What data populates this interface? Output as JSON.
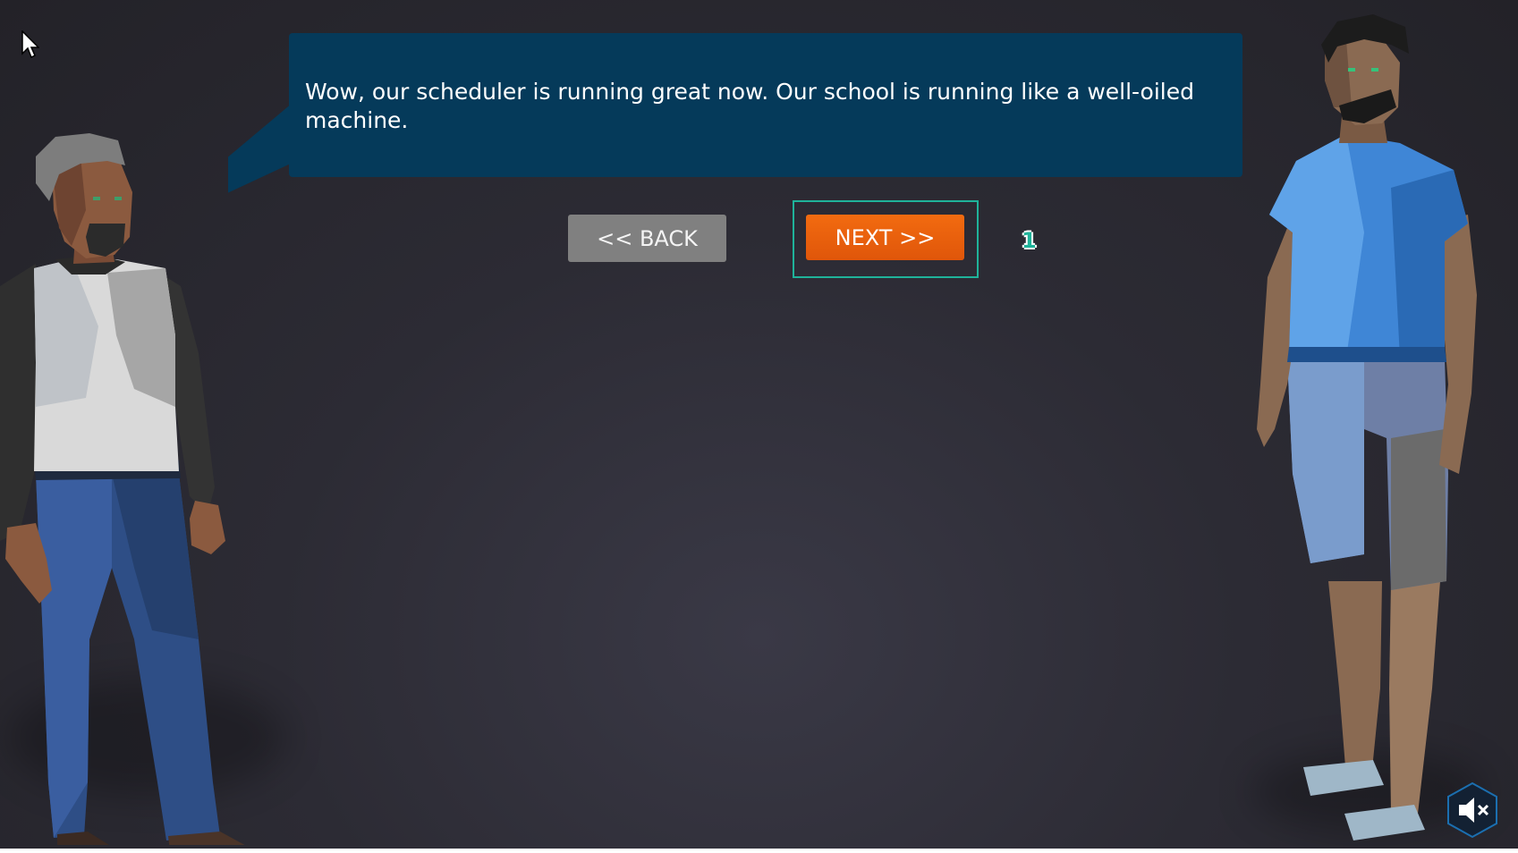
{
  "dialog": {
    "text": "Wow, our scheduler is running great now. Our school is running like a well-oiled machine."
  },
  "buttons": {
    "back_label": "<< BACK",
    "next_label": "NEXT >>"
  },
  "step_indicator": "1",
  "colors": {
    "bubble": "#053a5a",
    "next_button": "#f26b10",
    "back_button": "#808080",
    "focus_ring": "#1fb39a",
    "background": "#2c2b34"
  },
  "icons": {
    "cursor": "mouse-pointer-icon",
    "mute": "speaker-muted-icon"
  }
}
